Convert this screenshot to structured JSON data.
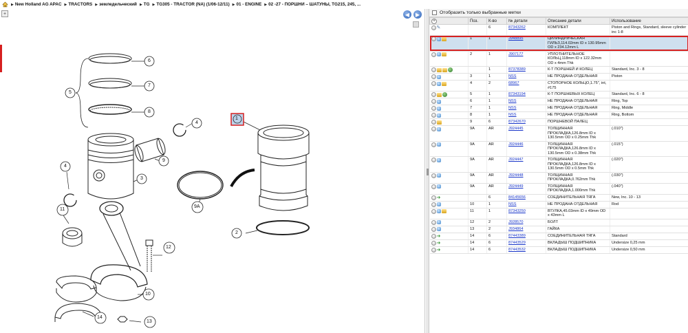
{
  "breadcrumb": [
    "New Holland AG APAC",
    "TRACTORS",
    "земледельческий",
    "TG",
    "TG305 - TRACTOR (NA) (1/06-12/11)",
    "01 - ENGINE",
    "02 -27 - ПОРШНИ – ШАТУНЫ, TG215, 245, ..."
  ],
  "filter_label": "Отобразить только выбранные метки",
  "columns": [
    "Поз.",
    "К-во",
    "№ детали",
    "Описание детали",
    "Использование"
  ],
  "callouts": [
    "1",
    "2",
    "3",
    "4",
    "4",
    "5",
    "6",
    "7",
    "8",
    "9",
    "9A",
    "10",
    "11",
    "12",
    "13",
    "14",
    "14"
  ],
  "rows": [
    {
      "icons": [
        "o",
        "k"
      ],
      "pos": "",
      "qty": "6",
      "part": "87343262",
      "desc": "КОМПЛЕКТ",
      "use": "Piston and Rings, Standard, sleeve cylinder inc 1-8",
      "sel": false
    },
    {
      "icons": [
        "o",
        "b",
        "y"
      ],
      "pos": "1",
      "qty": "1",
      "part": "J948895",
      "desc": "ЦИЛИНДРИЧЕСКАЯ ГИЛЬЗ,114.02mm ID x 130.95mm OD x 234.12mm L",
      "use": "",
      "sel": true
    },
    {
      "icons": [
        "o",
        "b",
        "y"
      ],
      "pos": "2",
      "qty": "1",
      "part": "J907177",
      "desc": "УПЛОТНИТЕЛЬНОЕ КОЛЬЦ,118mm ID x 122.32mm OD x 4mm Thk",
      "use": "",
      "sel": false
    },
    {
      "icons": [
        "o",
        "y",
        "y",
        "g"
      ],
      "pos": "",
      "qty": "1",
      "part": "87378389",
      "desc": "К-Т ПОРШНЕЙ И КОЛЕЦ",
      "use": "Standard, Inc. 3 - 8",
      "sel": false
    },
    {
      "icons": [
        "o",
        "b"
      ],
      "pos": "3",
      "qty": "1",
      "part": "NSS",
      "desc": "НЕ ПРОДАНА ОТДЕЛЬНАЯ",
      "use": "Piston",
      "sel": false
    },
    {
      "icons": [
        "o",
        "b",
        "y"
      ],
      "pos": "4",
      "qty": "2",
      "part": "68967",
      "desc": "СТОПОРНОЕ КОЛЬЦО,1.75\", int, #175",
      "use": "",
      "sel": false
    },
    {
      "icons": [
        "o",
        "y",
        "g"
      ],
      "pos": "5",
      "qty": "1",
      "part": "87343194",
      "desc": "К-Т ПОРШНЕВЫХ КОЛЕЦ",
      "use": "Standard, Inc. 6 - 8",
      "sel": false
    },
    {
      "icons": [
        "o",
        "b"
      ],
      "pos": "6",
      "qty": "1",
      "part": "NSS",
      "desc": "НЕ ПРОДАНА ОТДЕЛЬНАЯ",
      "use": "Ring, Top",
      "sel": false
    },
    {
      "icons": [
        "o",
        "b"
      ],
      "pos": "7",
      "qty": "1",
      "part": "NSS",
      "desc": "НЕ ПРОДАНА ОТДЕЛЬНАЯ",
      "use": "Ring, Middle",
      "sel": false
    },
    {
      "icons": [
        "o",
        "b"
      ],
      "pos": "8",
      "qty": "1",
      "part": "NSS",
      "desc": "НЕ ПРОДАНА ОТДЕЛЬНАЯ",
      "use": "Ring, Bottom",
      "sel": false
    },
    {
      "icons": [
        "o",
        "y"
      ],
      "pos": "9",
      "qty": "6",
      "part": "87342670",
      "desc": "ПОРШНЕВОЙ ПАЛЕЦ",
      "use": "",
      "sel": false
    },
    {
      "icons": [
        "o",
        "b"
      ],
      "pos": "9A",
      "qty": "AR",
      "part": "J924445",
      "desc": "ТОЛЩИННАЯ ПРОКЛАДКА,126.8mm ID x 130.5mm OD x 0.25mm Thk",
      "use": "(.010\")",
      "sel": false
    },
    {
      "icons": [
        "o",
        "b"
      ],
      "pos": "9A",
      "qty": "AR",
      "part": "J924446",
      "desc": "ТОЛЩИННАЯ ПРОКЛАДКА,126.8mm ID x 130.5mm OD x 0.38mm Thk",
      "use": "(.015\")",
      "sel": false
    },
    {
      "icons": [
        "o",
        "b"
      ],
      "pos": "9A",
      "qty": "AR",
      "part": "J924447",
      "desc": "ТОЛЩИННАЯ ПРОКЛАДКА,126.8mm ID x 130.5mm OD x 0.5mm Thk",
      "use": "(.020\")",
      "sel": false
    },
    {
      "icons": [
        "o",
        "b"
      ],
      "pos": "9A",
      "qty": "AR",
      "part": "J924448",
      "desc": "ТОЛЩИННАЯ ПРОКЛАДКА,0.762mm Thk",
      "use": "(.030\")",
      "sel": false
    },
    {
      "icons": [
        "o",
        "b"
      ],
      "pos": "9A",
      "qty": "AR",
      "part": "J924449",
      "desc": "ТОЛЩИННАЯ ПРОКЛАДКА,1.000mm Thk",
      "use": "(.040\")",
      "sel": false
    },
    {
      "icons": [
        "o",
        "gr"
      ],
      "pos": "",
      "qty": "6",
      "part": "84145656",
      "desc": "СОЕДИНИТЕЛЬНАЯ ТЯГА",
      "use": "New, Inc. 10 - 13",
      "sel": false
    },
    {
      "icons": [
        "o",
        "b"
      ],
      "pos": "10",
      "qty": "1",
      "part": "NSS",
      "desc": "НЕ ПРОДАНА ОТДЕЛЬНАЯ",
      "use": "Rod",
      "sel": false
    },
    {
      "icons": [
        "o",
        "b",
        "y"
      ],
      "pos": "11",
      "qty": "1",
      "part": "87343250",
      "desc": "ВТУЛКА,45.03mm ID x 49mm OD x 43mm L",
      "use": "",
      "sel": false
    },
    {
      "icons": [
        "o",
        "b"
      ],
      "pos": "12",
      "qty": "2",
      "part": "J928570",
      "desc": "БОЛТ",
      "use": "",
      "sel": false
    },
    {
      "icons": [
        "o",
        "b"
      ],
      "pos": "13",
      "qty": "2",
      "part": "J934864",
      "desc": "ГАЙКА",
      "use": "",
      "sel": false
    },
    {
      "icons": [
        "o",
        "gr"
      ],
      "pos": "14",
      "qty": "6",
      "part": "87443389",
      "desc": "СОЕДИНИТЕЛЬНАЯ ТЯГА",
      "use": "Standard",
      "sel": false
    },
    {
      "icons": [
        "o",
        "gr"
      ],
      "pos": "14",
      "qty": "6",
      "part": "87443529",
      "desc": "ВКЛАДЫШ ПОДШИПНИКА",
      "use": "Undersize 0,25 mm",
      "sel": false
    },
    {
      "icons": [
        "o",
        "gr"
      ],
      "pos": "14",
      "qty": "6",
      "part": "87443532",
      "desc": "ВКЛАДЫШ ПОДШИПНИКА",
      "use": "Undersize 0,50 mm",
      "sel": false
    }
  ]
}
